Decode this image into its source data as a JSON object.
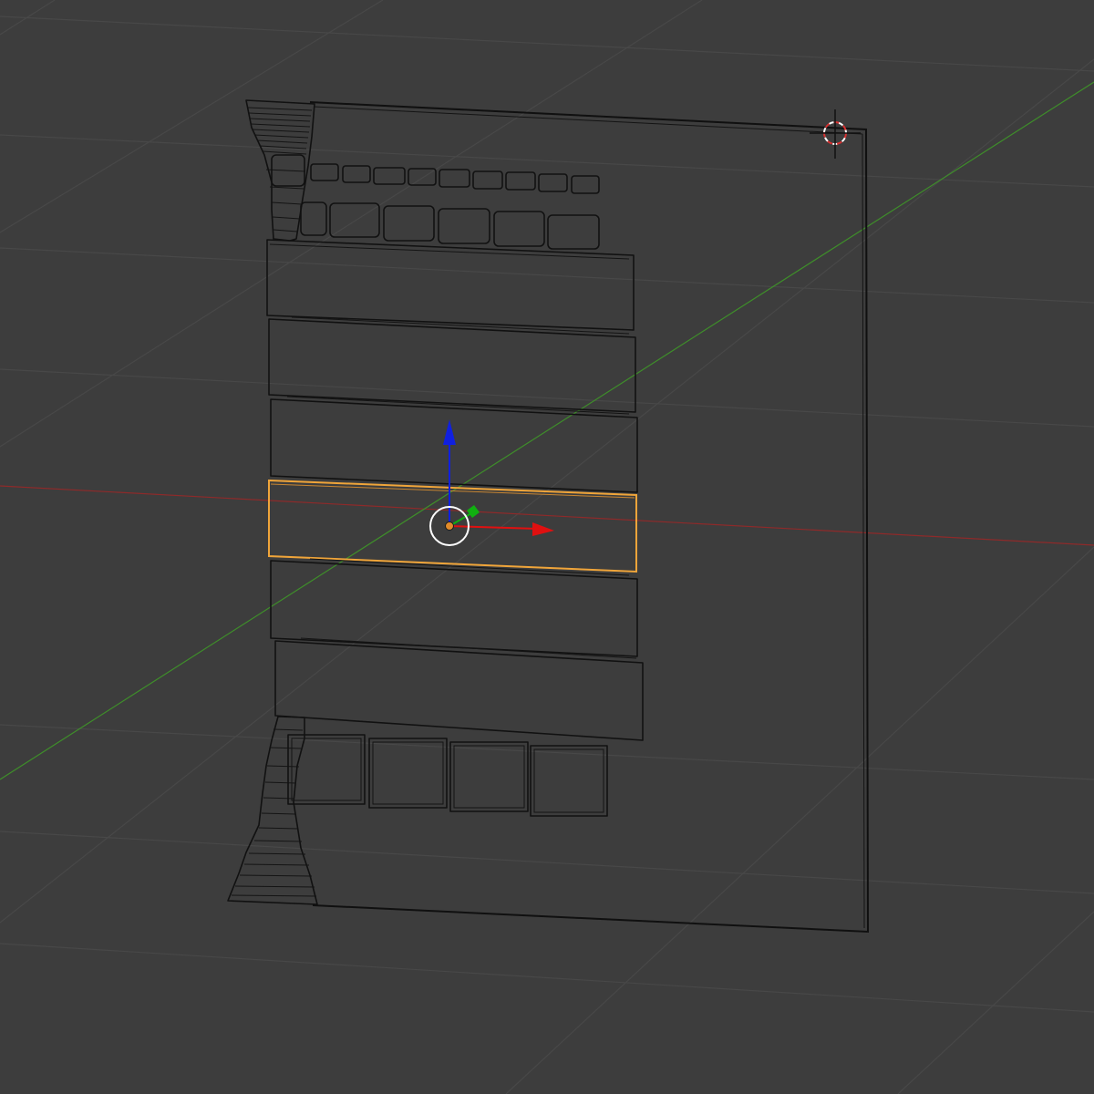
{
  "viewport": {
    "background": "#3d3d3d",
    "grid_color": "#484848",
    "wire_color": "#111111",
    "selection_color": "#f0a53a",
    "x_axis_color": "#8e2a2a",
    "y_axis_color": "#3e8e2a",
    "gizmo": {
      "x_arrow_color": "#e01010",
      "y_handle_color": "#10b010",
      "z_arrow_color": "#1020e0",
      "pivot_color": "#e08a2a"
    },
    "cursor_3d_icon": "3d-cursor-icon",
    "mesh_description_icon": "wireframe-mesh",
    "selected_object": "plank-4"
  }
}
